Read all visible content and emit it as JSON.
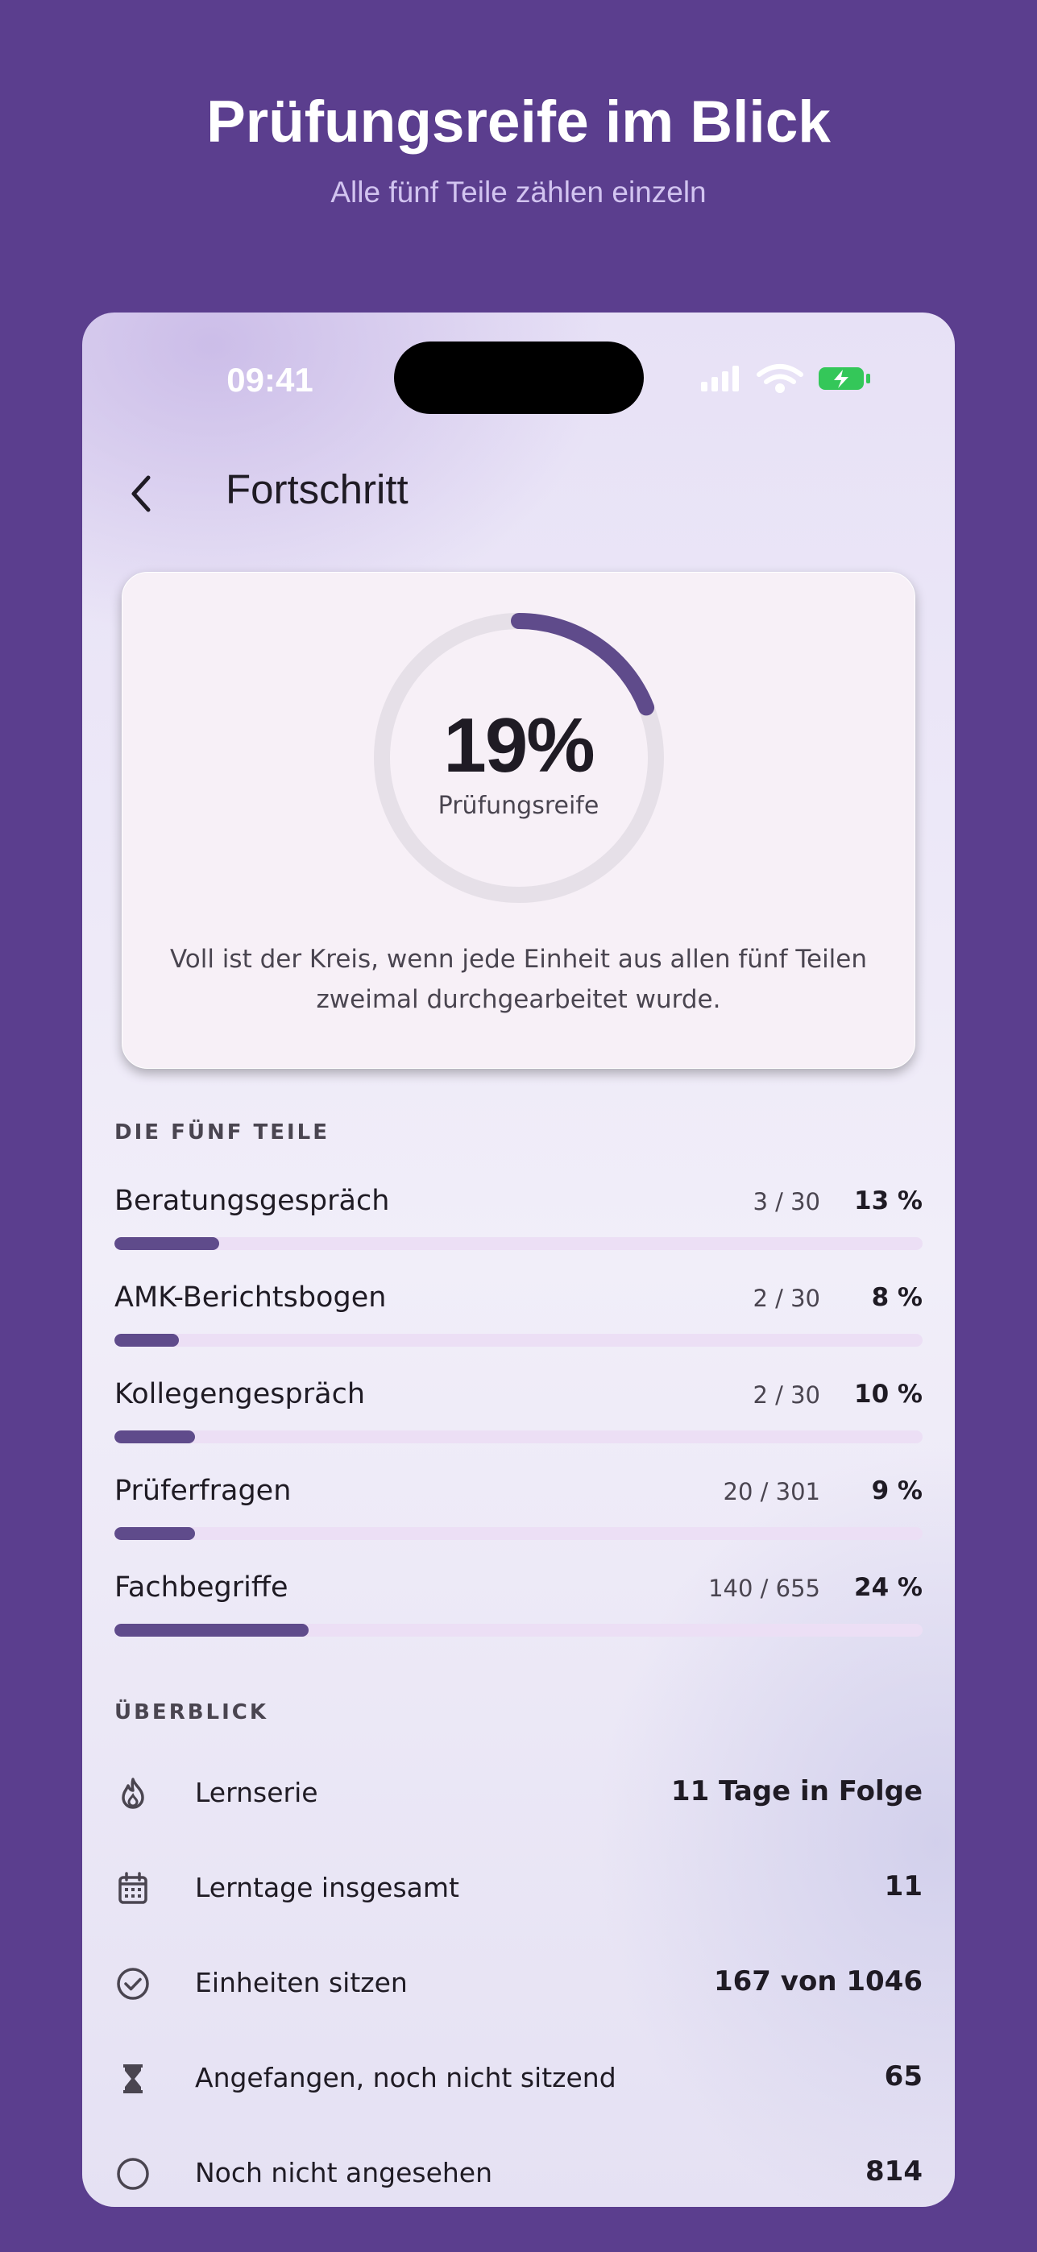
{
  "hero": {
    "title": "Prüfungsreife im Blick",
    "subtitle": "Alle fünf Teile zählen einzeln"
  },
  "status_bar": {
    "time": "09:41",
    "icons": [
      "cellular-signal-icon",
      "wifi-icon",
      "battery-charging-icon"
    ],
    "battery_color": "#34c759"
  },
  "nav": {
    "back_icon": "chevron-left-icon",
    "title": "Fortschritt"
  },
  "summary": {
    "percent_value": 0.19,
    "percent_text": "19%",
    "label": "Prüfungsreife",
    "note": "Voll ist der Kreis, wenn jede Einheit aus allen fünf Teilen zweimal durchgearbeitet wurde."
  },
  "parts": {
    "heading": "DIE FÜNF TEILE",
    "items": [
      {
        "name": "Beratungsgespräch",
        "count": "3 / 30",
        "percent": "13 %",
        "fraction": 0.13
      },
      {
        "name": "AMK-Berichtsbogen",
        "count": "2 / 30",
        "percent": "8 %",
        "fraction": 0.08
      },
      {
        "name": "Kollegengespräch",
        "count": "2 / 30",
        "percent": "10 %",
        "fraction": 0.1
      },
      {
        "name": "Prüferfragen",
        "count": "20 / 301",
        "percent": "9 %",
        "fraction": 0.1
      },
      {
        "name": "Fachbegriffe",
        "count": "140 / 655",
        "percent": "24 %",
        "fraction": 0.24
      }
    ]
  },
  "overview": {
    "heading": "ÜBERBLICK",
    "items": [
      {
        "icon": "flame-icon",
        "label": "Lernserie",
        "value": "11 Tage in Folge"
      },
      {
        "icon": "calendar-icon",
        "label": "Lerntage insgesamt",
        "value": "11"
      },
      {
        "icon": "check-circle-icon",
        "label": "Einheiten sitzen",
        "value": "167 von 1046"
      },
      {
        "icon": "hourglass-icon",
        "label": "Angefangen, noch nicht sitzend",
        "value": "65"
      },
      {
        "icon": "empty-circle-icon",
        "label": "Noch nicht angesehen",
        "value": "814"
      }
    ]
  },
  "colors": {
    "background": "#5b3e8e",
    "accent": "#5f4b8b",
    "bar_track": "#ecdff5",
    "ring_track": "#e6e0e8"
  }
}
